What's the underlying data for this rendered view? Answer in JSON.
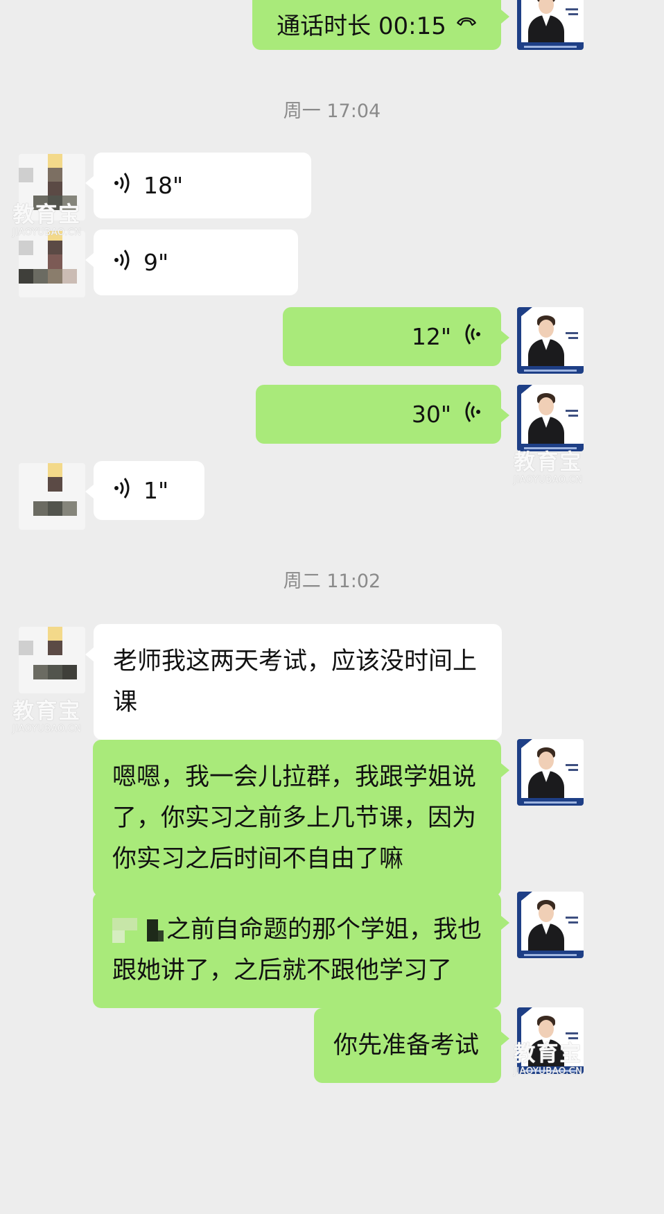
{
  "timestamps": [
    "周一 17:04",
    "周二 11:02"
  ],
  "call": {
    "label": "通话时长 00:15"
  },
  "voice_messages": [
    {
      "direction": "in",
      "duration": "18\""
    },
    {
      "direction": "in",
      "duration": "9\""
    },
    {
      "direction": "out",
      "duration": "12\""
    },
    {
      "direction": "out",
      "duration": "30\""
    },
    {
      "direction": "in",
      "duration": "1\""
    }
  ],
  "text_messages": [
    {
      "direction": "in",
      "text": "老师我这两天考试，应该没时间上课"
    },
    {
      "direction": "out",
      "text": "嗯嗯，我一会儿拉群，我跟学姐说了，你实习之前多上几节课，因为你实习之后时间不自由了嘛"
    },
    {
      "direction": "out",
      "text": "之前自命题的那个学姐，我也跟她讲了，之后就不跟他学习了"
    },
    {
      "direction": "out",
      "text": "你先准备考试"
    }
  ],
  "watermark": {
    "cn": "教育宝",
    "en": "JIAOYUBAO.CN"
  },
  "colors": {
    "background": "#ededed",
    "incoming_bubble": "#ffffff",
    "outgoing_bubble": "#a9ea7a",
    "timestamp_text": "#8a8a8a"
  },
  "icons": {
    "call": "phone-hangup-icon",
    "voice_in": "voice-waves-right-icon",
    "voice_out": "voice-waves-left-icon"
  }
}
